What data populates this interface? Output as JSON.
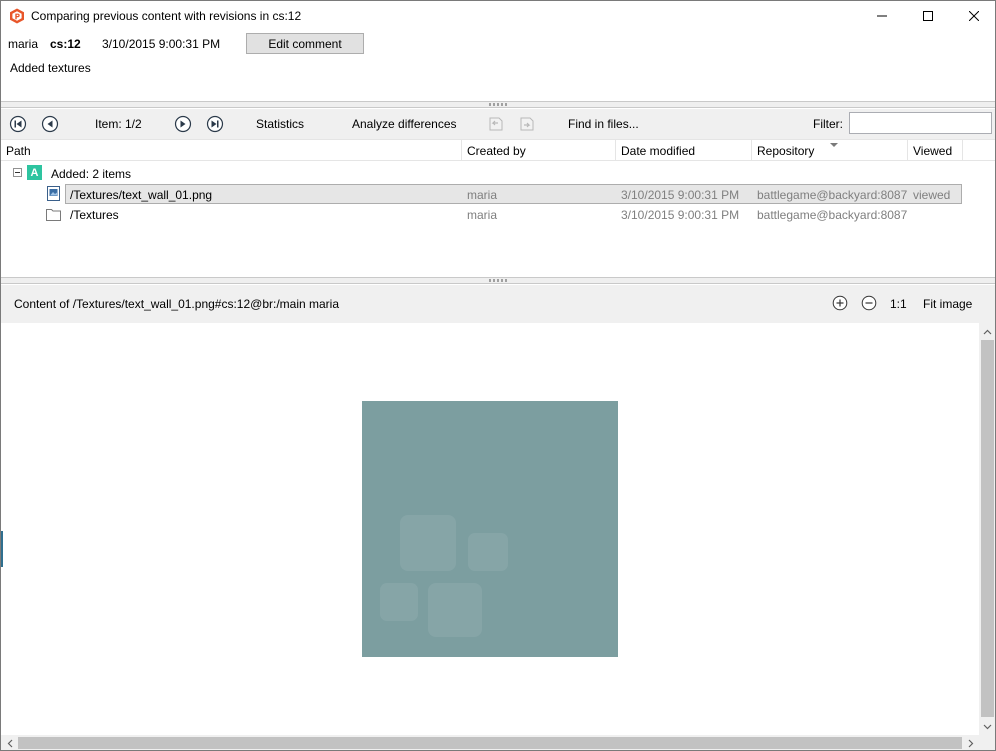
{
  "window": {
    "title": "Comparing previous content with revisions in cs:12",
    "icon": "plastic-scm-logo-icon",
    "controls": [
      "minimize-icon",
      "maximize-icon",
      "close-icon"
    ]
  },
  "changeset": {
    "user": "maria",
    "cs": "cs:12",
    "date": "3/10/2015 9:00:31 PM",
    "edit_comment_label": "Edit comment",
    "comment": "Added textures"
  },
  "toolbar": {
    "first_icon": "first-item-icon",
    "prev_icon": "previous-item-icon",
    "item_counter": "Item: 1/2",
    "next_icon": "next-item-icon",
    "last_icon": "last-item-icon",
    "statistics_label": "Statistics",
    "analyze_label": "Analyze differences",
    "find_label": "Find in files...",
    "filter_label": "Filter:",
    "filter_value": ""
  },
  "columns": {
    "path": "Path",
    "created_by": "Created by",
    "date_modified": "Date modified",
    "repository": "Repository",
    "viewed": "Viewed"
  },
  "tree": {
    "group_label": "Added: 2 items",
    "group_badge": "A",
    "items": [
      {
        "path": "/Textures/text_wall_01.png",
        "created_by": "maria",
        "date_modified": "3/10/2015 9:00:31 PM",
        "repository": "battlegame@backyard:8087",
        "viewed": "viewed",
        "icon": "image-file-icon"
      },
      {
        "path": "/Textures",
        "created_by": "maria",
        "date_modified": "3/10/2015 9:00:31 PM",
        "repository": "battlegame@backyard:8087",
        "viewed": "",
        "icon": "folder-icon"
      }
    ]
  },
  "content_pane": {
    "title": "Content of /Textures/text_wall_01.png#cs:12@br:/main maria",
    "zoom_in_icon": "zoom-in-icon",
    "zoom_out_icon": "zoom-out-icon",
    "actual_size_label": "1:1",
    "fit_image_label": "Fit image"
  },
  "colors": {
    "added_badge": "#2ec4a0",
    "preview_image": "#7c9ea0",
    "app_accent": "#e8562a"
  }
}
